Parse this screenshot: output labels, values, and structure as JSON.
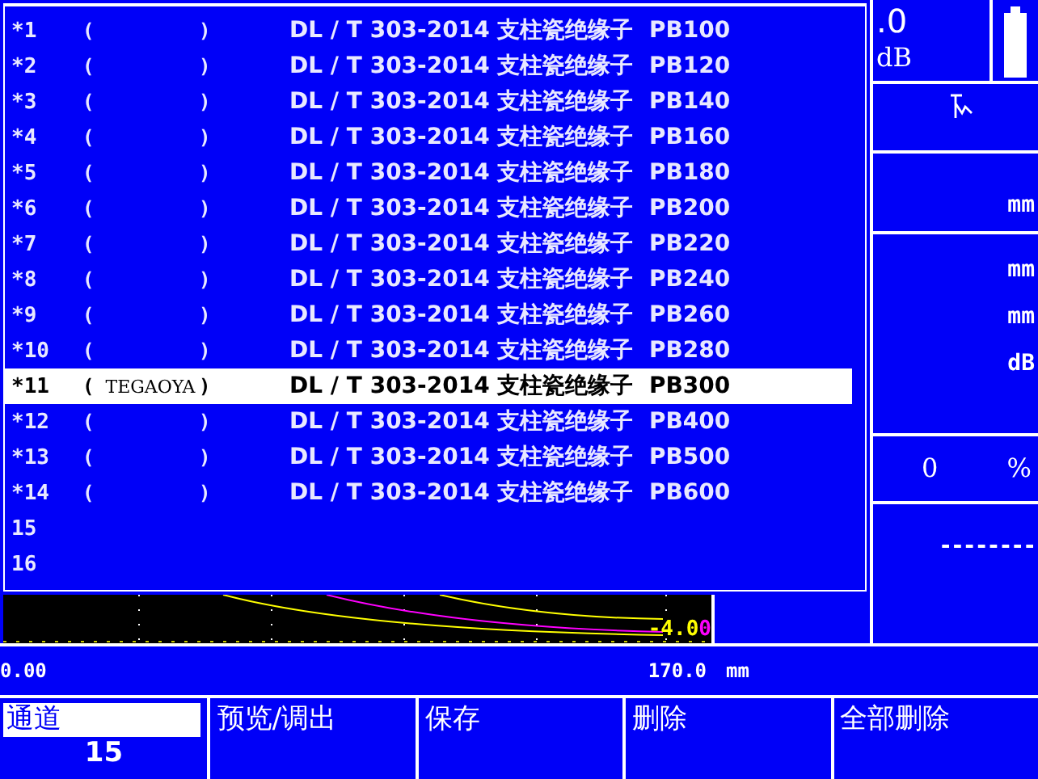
{
  "probe_list": {
    "rows": [
      {
        "index": "*1",
        "name_field": {
          "open": "(",
          "close": ")"
        },
        "standard": "DL / T 303-2014 支柱瓷绝缘子  PB100",
        "selected": false
      },
      {
        "index": "*2",
        "name_field": {
          "open": "(",
          "close": ")"
        },
        "standard": "DL / T 303-2014 支柱瓷绝缘子  PB120",
        "selected": false
      },
      {
        "index": "*3",
        "name_field": {
          "open": "(",
          "close": ")"
        },
        "standard": "DL / T 303-2014 支柱瓷绝缘子  PB140",
        "selected": false
      },
      {
        "index": "*4",
        "name_field": {
          "open": "(",
          "close": ")"
        },
        "standard": "DL / T 303-2014 支柱瓷绝缘子  PB160",
        "selected": false
      },
      {
        "index": "*5",
        "name_field": {
          "open": "(",
          "close": ")"
        },
        "standard": "DL / T 303-2014 支柱瓷绝缘子  PB180",
        "selected": false
      },
      {
        "index": "*6",
        "name_field": {
          "open": "(",
          "close": ")"
        },
        "standard": "DL / T 303-2014 支柱瓷绝缘子  PB200",
        "selected": false
      },
      {
        "index": "*7",
        "name_field": {
          "open": "(",
          "close": ")"
        },
        "standard": "DL / T 303-2014 支柱瓷绝缘子  PB220",
        "selected": false
      },
      {
        "index": "*8",
        "name_field": {
          "open": "(",
          "close": ")"
        },
        "standard": "DL / T 303-2014 支柱瓷绝缘子  PB240",
        "selected": false
      },
      {
        "index": "*9",
        "name_field": {
          "open": "(",
          "close": ")"
        },
        "standard": "DL / T 303-2014 支柱瓷绝缘子  PB260",
        "selected": false
      },
      {
        "index": "*10",
        "name_field": {
          "open": "(",
          "close": ")"
        },
        "standard": "DL / T 303-2014 支柱瓷绝缘子  PB280",
        "selected": false
      },
      {
        "index": "*11",
        "name_field": {
          "open": "(",
          "text": "TEGAOYA",
          "close": ")"
        },
        "standard": "DL / T 303-2014 支柱瓷绝缘子  PB300",
        "selected": true
      },
      {
        "index": "*12",
        "name_field": {
          "open": "(",
          "close": ")"
        },
        "standard": "DL / T 303-2014 支柱瓷绝缘子  PB400",
        "selected": false
      },
      {
        "index": "*13",
        "name_field": {
          "open": "(",
          "close": ")"
        },
        "standard": "DL / T 303-2014 支柱瓷绝缘子  PB500",
        "selected": false
      },
      {
        "index": "*14",
        "name_field": {
          "open": "(",
          "close": ")"
        },
        "standard": "DL / T 303-2014 支柱瓷绝缘子  PB600",
        "selected": false
      },
      {
        "index": "15",
        "selected": false
      },
      {
        "index": "16",
        "selected": false
      }
    ]
  },
  "side_panel": {
    "gain_value": ".0",
    "gain_unit": "dB",
    "range_unit": "mm",
    "depth_unit": "mm",
    "distance_unit": "mm",
    "level_unit": "dB",
    "percent_value": "0",
    "percent_unit": "%",
    "reading": "--------"
  },
  "curve_label": {
    "parts": [
      {
        "text": "-4.0",
        "color": "#ffff00"
      },
      {
        "text": "0",
        "color": "#ff00ff"
      }
    ]
  },
  "axis": {
    "start": "0.00",
    "end": "170.0",
    "unit": "mm"
  },
  "softkeys": [
    {
      "label": "通道",
      "value": "15",
      "selected": true
    },
    {
      "label": "预览/调出",
      "selected": false
    },
    {
      "label": "保存",
      "selected": false
    },
    {
      "label": "删除",
      "selected": false
    },
    {
      "label": "全部删除",
      "selected": false
    }
  ]
}
